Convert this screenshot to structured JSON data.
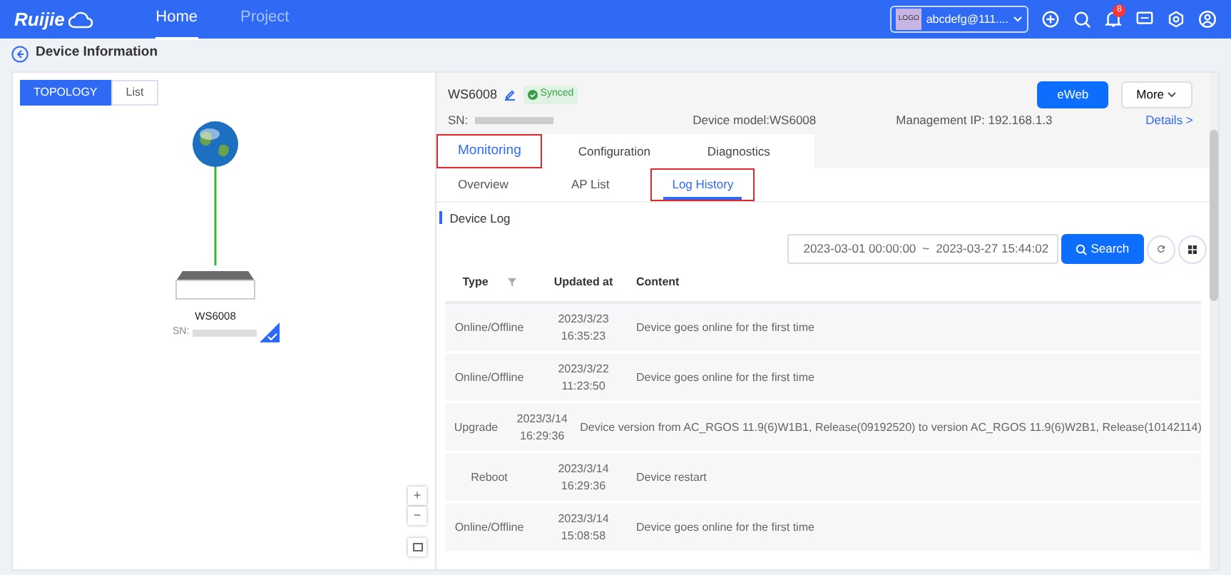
{
  "brand": {
    "name": "Ruijie"
  },
  "nav": [
    {
      "label": "Home",
      "selected": true
    },
    {
      "label": "Project",
      "selected": false
    }
  ],
  "account": {
    "logo": "LOGO",
    "name": "abcdefg@111...."
  },
  "notifications": {
    "count": "8"
  },
  "page_title": "Device Information",
  "view_toggle": [
    {
      "label": "TOPOLOGY",
      "selected": true
    },
    {
      "label": "List",
      "selected": false
    }
  ],
  "topology": {
    "device_name": "WS6008",
    "device_sn_label": "SN:"
  },
  "device": {
    "name": "WS6008",
    "status": "Synced",
    "sn_label": "SN:",
    "model": "Device model:WS6008",
    "ip_label": "Management IP:",
    "ip": "192.168.1.3",
    "details": "Details >"
  },
  "buttons": {
    "eweb": "eWeb",
    "more": "More"
  },
  "tabs": [
    {
      "label": "Monitoring",
      "selected": true,
      "highlighted": true
    },
    {
      "label": "Configuration",
      "selected": false,
      "highlighted": false
    },
    {
      "label": "Diagnostics",
      "selected": false,
      "highlighted": false
    }
  ],
  "subtabs": [
    {
      "label": "Overview",
      "selected": false,
      "highlighted": false
    },
    {
      "label": "AP List",
      "selected": false,
      "highlighted": false
    },
    {
      "label": "Log History",
      "selected": true,
      "highlighted": true
    }
  ],
  "section_title": "Device Log",
  "date_range": {
    "start": "2023-03-01 00:00:00",
    "separator": "~",
    "end": "2023-03-27 15:44:02"
  },
  "search_button": "Search",
  "table": {
    "columns": [
      "Type",
      "Updated at",
      "Content"
    ],
    "rows": [
      {
        "type": "Online/Offline",
        "date": "2023/3/23",
        "time": "16:35:23",
        "content": "Device goes online for the first time"
      },
      {
        "type": "Online/Offline",
        "date": "2023/3/22",
        "time": "11:23:50",
        "content": "Device goes online for the first time"
      },
      {
        "type": "Upgrade",
        "date": "2023/3/14",
        "time": "16:29:36",
        "content": "Device version from AC_RGOS 11.9(6)W1B1, Release(09192520) to version AC_RGOS 11.9(6)W2B1, Release(10142114)"
      },
      {
        "type": "Reboot",
        "date": "2023/3/14",
        "time": "16:29:36",
        "content": "Device restart"
      },
      {
        "type": "Online/Offline",
        "date": "2023/3/14",
        "time": "15:08:58",
        "content": "Device goes online for the first time"
      }
    ]
  },
  "zoom_controls": [
    "+",
    "−"
  ]
}
